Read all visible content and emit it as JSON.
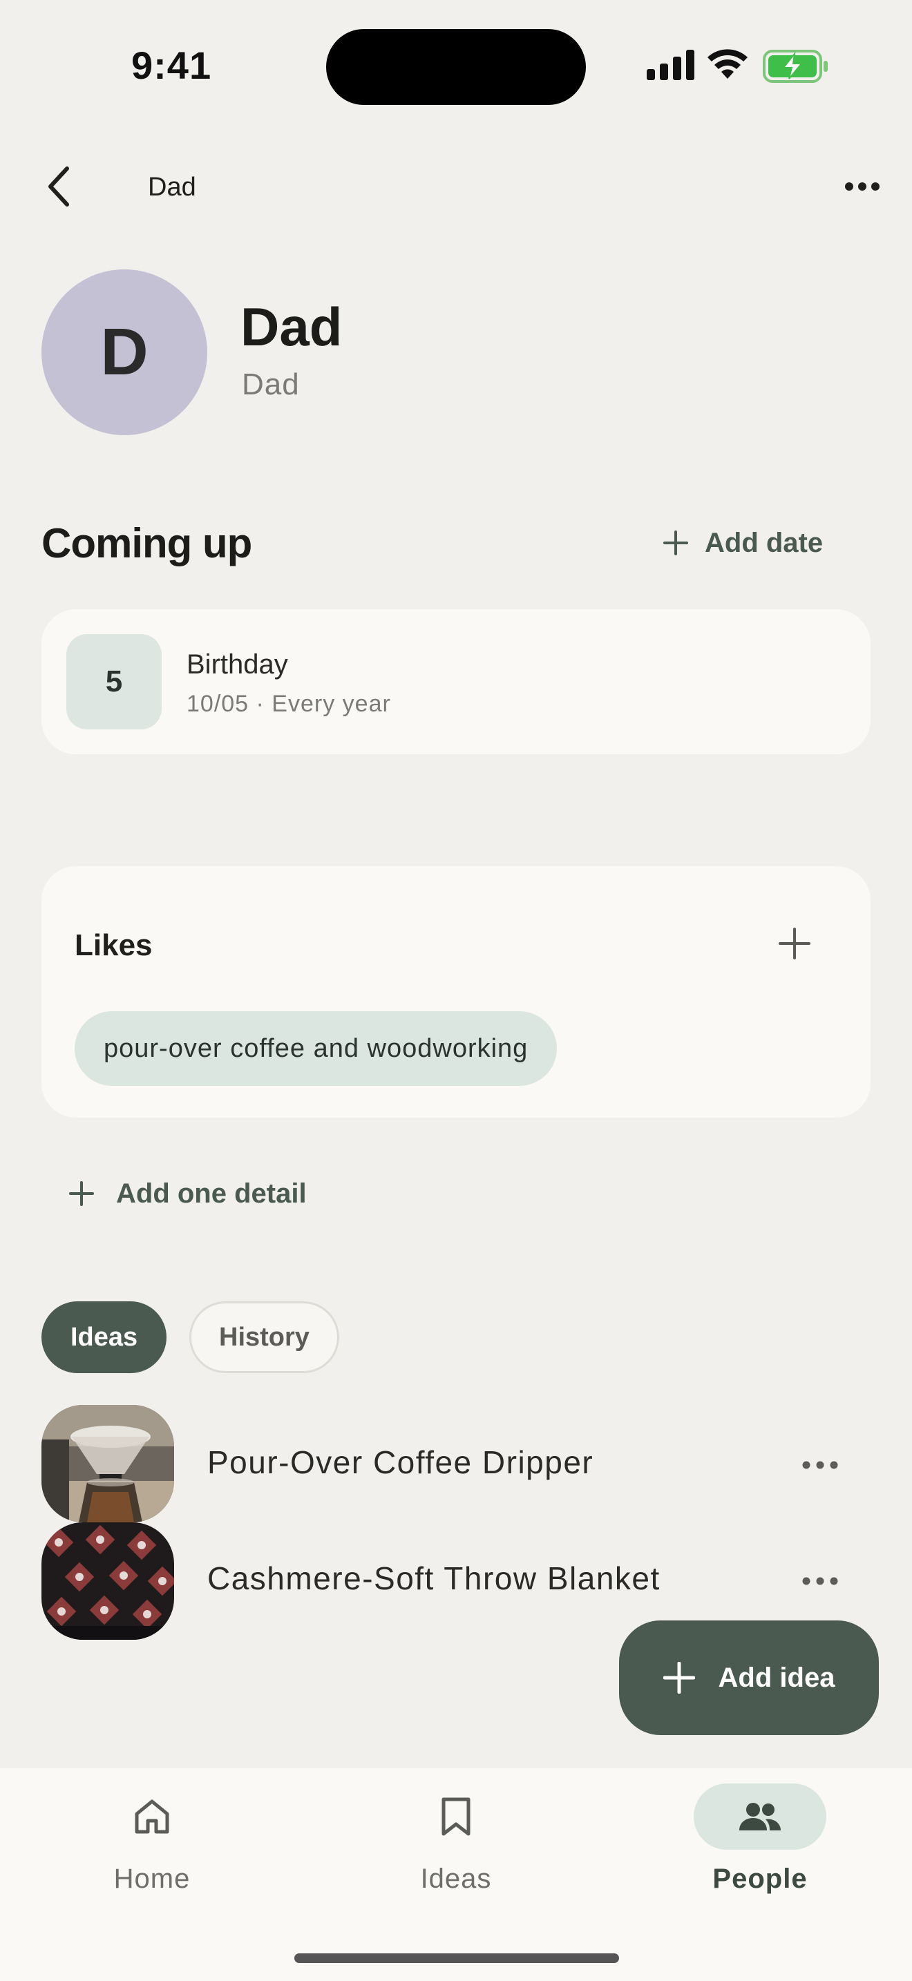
{
  "status_bar": {
    "time": "9:41"
  },
  "header": {
    "title": "Dad"
  },
  "profile": {
    "initial": "D",
    "name": "Dad",
    "relation": "Dad"
  },
  "coming_up": {
    "title": "Coming up",
    "add_label": "Add date",
    "events": [
      {
        "day": "5",
        "title": "Birthday",
        "subtitle": "10/05 · Every year"
      }
    ]
  },
  "likes": {
    "title": "Likes",
    "items": [
      "pour-over coffee and woodworking"
    ]
  },
  "add_detail_label": "Add one detail",
  "tabs": [
    {
      "label": "Ideas",
      "active": true
    },
    {
      "label": "History",
      "active": false
    }
  ],
  "ideas": [
    {
      "title": "Pour-Over Coffee Dripper"
    },
    {
      "title": "Cashmere-Soft Throw Blanket"
    }
  ],
  "fab": {
    "label": "Add idea"
  },
  "nav": [
    {
      "label": "Home",
      "icon": "home-icon"
    },
    {
      "label": "Ideas",
      "icon": "bookmark-icon"
    },
    {
      "label": "People",
      "icon": "people-icon",
      "active": true
    }
  ],
  "colors": {
    "background": "#f1f0ed",
    "accent": "#4a5a50",
    "avatar": "#c5c1d4",
    "chip": "#dce6e0",
    "card": "#faf9f6"
  }
}
